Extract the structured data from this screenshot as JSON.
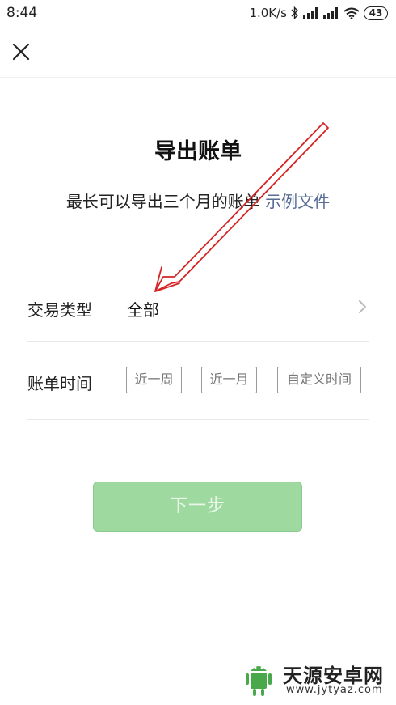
{
  "status_bar": {
    "time": "8:44",
    "speed": "1.0K/s",
    "battery": "43"
  },
  "top_bar": {
    "close_icon": "close-icon"
  },
  "main": {
    "title": "导出账单",
    "subtitle": "最长可以导出三个月的账单",
    "example_link": "示例文件"
  },
  "rows": {
    "transaction_type": {
      "label": "交易类型",
      "value": "全部",
      "icon": "chevron-right-icon"
    },
    "bill_time": {
      "label": "账单时间",
      "options": [
        "近一周",
        "近一月",
        "自定义时间"
      ]
    }
  },
  "next_button": {
    "label": "下一步",
    "color": "#9ed99f"
  },
  "annotation": {
    "arrow_color": "#d42424"
  },
  "watermark": {
    "title": "天源安卓网",
    "url": "www.jytyaz.com"
  }
}
